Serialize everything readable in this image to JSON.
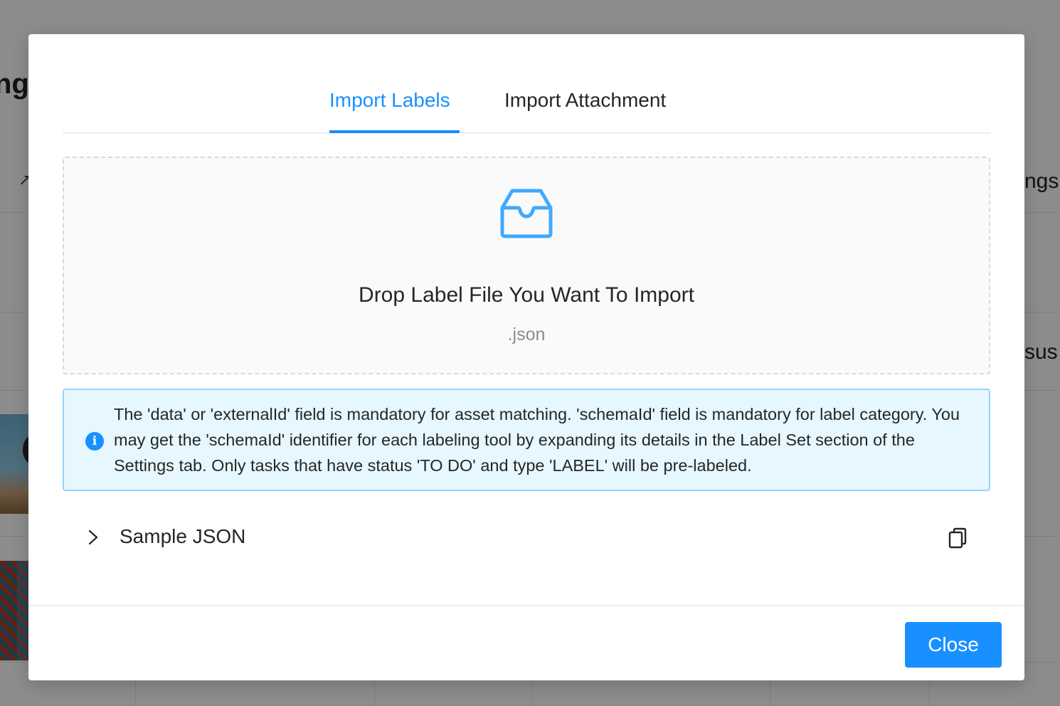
{
  "background": {
    "heading_fragment": "nge",
    "right_text_1": "ngs",
    "right_text_2": "sus"
  },
  "modal": {
    "tabs": [
      {
        "label": "Import Labels",
        "active": true
      },
      {
        "label": "Import Attachment",
        "active": false
      }
    ],
    "dropzone": {
      "icon": "inbox-icon",
      "title": "Drop Label File You Want To Import",
      "hint": ".json"
    },
    "alert": {
      "icon": "info-icon",
      "icon_glyph": "i",
      "text": "The 'data' or 'externalId' field is mandatory for asset matching. 'schemaId' field is mandatory for label category. You may get the 'schemaId' identifier for each labeling tool by expanding its details in the Label Set section of the Settings tab. Only tasks that have status 'TO DO' and type 'LABEL' will be pre-labeled."
    },
    "collapse": {
      "icon": "chevron-right-icon",
      "label": "Sample JSON",
      "copy_icon": "copy-icon"
    },
    "footer": {
      "close_label": "Close"
    }
  },
  "colors": {
    "primary": "#1890ff",
    "alert_bg": "#e6f7ff",
    "alert_border": "#91d5ff",
    "text": "#262626",
    "muted": "#8c8c8c"
  }
}
